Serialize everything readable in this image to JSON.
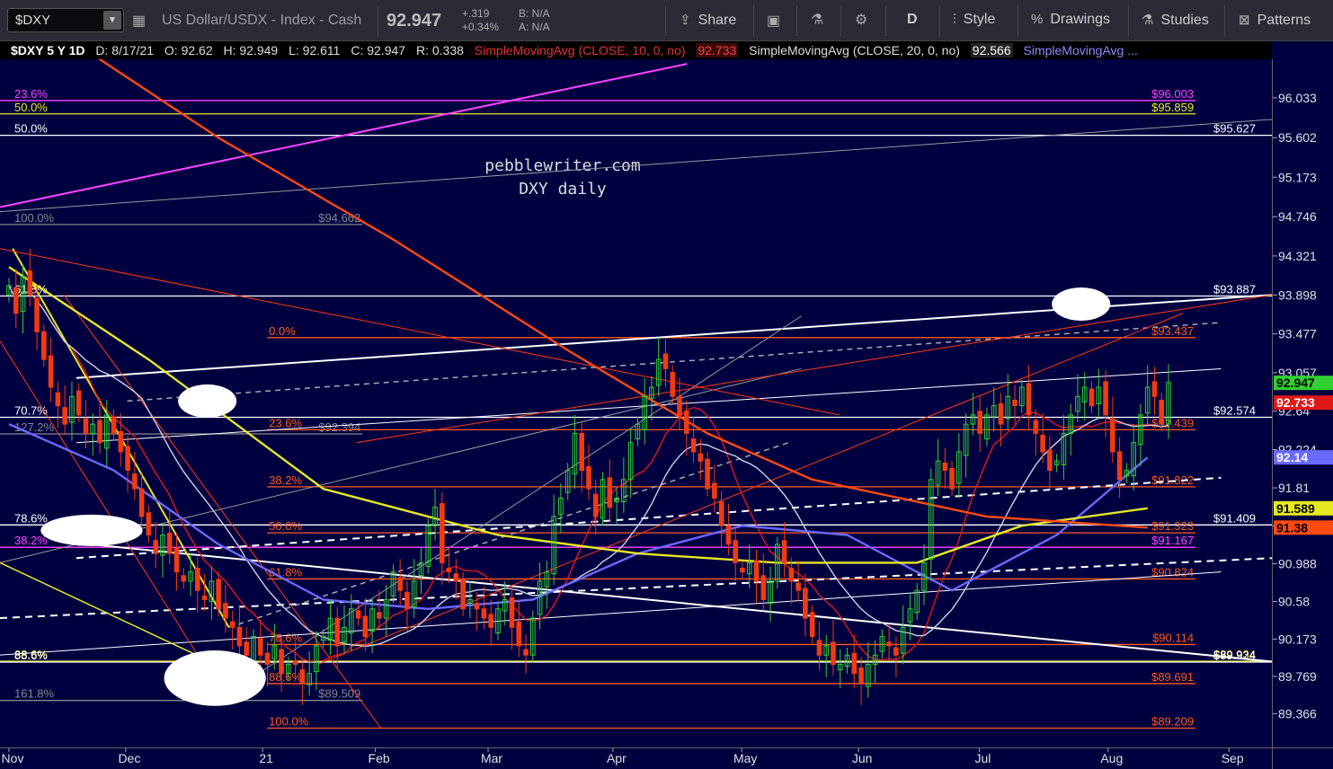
{
  "toolbar": {
    "symbol": "$DXY",
    "description": "US Dollar/USDX - Index - Cash",
    "last": "92.947",
    "change": "+.319",
    "change_pct": "+0.34%",
    "bid": "B: N/A",
    "ask": "A: N/A",
    "period_button": "D",
    "buttons": [
      {
        "label": "Share",
        "icon": "share-icon"
      },
      {
        "label": "Style",
        "icon": "style-icon"
      },
      {
        "label": "Drawings",
        "icon": "drawings-icon"
      },
      {
        "label": "Studies",
        "icon": "studies-icon"
      },
      {
        "label": "Patterns",
        "icon": "patterns-icon"
      }
    ]
  },
  "status": {
    "symbol": "$DXY 5 Y 1D",
    "date": "D: 8/17/21",
    "open": "O: 92.62",
    "high": "H: 92.949",
    "low": "L: 92.611",
    "close": "C: 92.947",
    "range": "R: 0.338",
    "sma10_label": "SimpleMovingAvg (CLOSE, 10, 0, no)",
    "sma10_value": "92.733",
    "sma20_label": "SimpleMovingAvg (CLOSE, 20, 0, no)",
    "sma20_value": "92.566",
    "sma_more_label": "SimpleMovingAvg ..."
  },
  "colors": {
    "background": "#000040",
    "up": "#2fd02f",
    "down": "#f03a10",
    "sma10": "#e01818",
    "sma20": "#d0d0e0",
    "sma50": "#6a6aff",
    "sma100": "#e8e820",
    "sma200": "#ff4a10",
    "fib_orange": "#ff5a1a",
    "fib_magenta": "#ff44ff"
  },
  "chart_data": {
    "type": "candlestick",
    "watermark_lines": [
      "pebblewriter.com",
      "DXY daily"
    ],
    "y_axis": {
      "range": [
        89.0,
        96.45
      ],
      "ticks": [
        96.033,
        95.602,
        95.173,
        94.746,
        94.321,
        93.898,
        93.477,
        93.057,
        92.64,
        92.224,
        91.81,
        91.398,
        90.988,
        90.58,
        90.173,
        89.769,
        89.366
      ],
      "tick_labels": [
        "96.033",
        "95.602",
        "95.173",
        "94.746",
        "94.321",
        "93.898",
        "93.477",
        "93.057",
        "92.64",
        "92.224",
        "91.81",
        "91.398",
        "90.988",
        "90.58",
        "90.173",
        "89.769",
        "89.366"
      ]
    },
    "x_axis": {
      "labels": [
        "Nov",
        "Dec",
        "21",
        "Feb",
        "Mar",
        "Apr",
        "May",
        "Jun",
        "Jul",
        "Aug",
        "Sep"
      ],
      "label_dates": [
        "2020-11-02",
        "2020-12-01",
        "2021-01-04",
        "2021-02-01",
        "2021-03-01",
        "2021-04-01",
        "2021-05-03",
        "2021-06-01",
        "2021-07-01",
        "2021-08-02",
        "2021-09-01"
      ],
      "last_date": "2021-08-17"
    },
    "price_markers": [
      {
        "label": "92.947",
        "value": 92.947,
        "color": "#2fd02f",
        "text": "#000000"
      },
      {
        "label": "92.733",
        "value": 92.733,
        "color": "#e01818",
        "text": "#ffffff"
      },
      {
        "label": "92.14",
        "value": 92.14,
        "color": "#6a6aff",
        "text": "#ffffff"
      },
      {
        "label": "91.589",
        "value": 91.589,
        "color": "#e8e820",
        "text": "#000000"
      },
      {
        "label": "91.38",
        "value": 91.38,
        "color": "#ff4a10",
        "text": "#000000"
      }
    ],
    "horizontal_levels": [
      {
        "value": 96.003,
        "color": "#ff44ff",
        "label_left": "23.6%",
        "label_right": "$96.003",
        "x_from": 0.0,
        "x_to": 0.94
      },
      {
        "value": 95.859,
        "color": "#e8e820",
        "label_left": "50.0%",
        "label_right": "$95.859",
        "x_from": 0.0,
        "x_to": 0.94
      },
      {
        "value": 95.627,
        "color": "#ffffff",
        "label_left": "50.0%",
        "label_right": "$95.627",
        "x_from": 0.0,
        "x_to": 1.0
      },
      {
        "value": 94.662,
        "color": "#888888",
        "label_left": "100.0%",
        "label_right": "$94.662",
        "x_from": 0.0,
        "x_to": 0.285
      },
      {
        "value": 93.887,
        "color": "#ffffff",
        "label_left": "61.8%",
        "label_right": "$93.887",
        "x_from": 0.0,
        "x_to": 1.0
      },
      {
        "value": 93.437,
        "color": "#ff5a1a",
        "label_left": "0.0%",
        "label_right": "$93.437",
        "x_from": 0.21,
        "x_to": 0.94
      },
      {
        "value": 92.574,
        "color": "#ffffff",
        "label_left": "70.7%",
        "label_right": "$92.574",
        "x_from": 0.0,
        "x_to": 1.0
      },
      {
        "value": 92.394,
        "color": "#888888",
        "label_left": "127.2%",
        "label_right": "$92.394",
        "x_from": 0.0,
        "x_to": 0.285
      },
      {
        "value": 92.439,
        "color": "#ff5a1a",
        "label_left": "23.6%",
        "label_right": "$92.439",
        "x_from": 0.21,
        "x_to": 0.94
      },
      {
        "value": 91.822,
        "color": "#ff5a1a",
        "label_left": "38.2%",
        "label_right": "$91.822",
        "x_from": 0.21,
        "x_to": 0.94
      },
      {
        "value": 91.409,
        "color": "#ffffff",
        "label_left": "78.6%",
        "label_right": "$91.409",
        "x_from": 0.0,
        "x_to": 1.0
      },
      {
        "value": 91.323,
        "color": "#ff5a1a",
        "label_left": "50.0%",
        "label_right": "$91.323",
        "x_from": 0.21,
        "x_to": 0.94
      },
      {
        "value": 91.167,
        "color": "#ff44ff",
        "label_left": "38.2%",
        "label_right": "$91.167",
        "x_from": 0.0,
        "x_to": 0.94
      },
      {
        "value": 90.824,
        "color": "#ff5a1a",
        "label_left": "61.8%",
        "label_right": "$90.824",
        "x_from": 0.21,
        "x_to": 0.94
      },
      {
        "value": 90.114,
        "color": "#ff5a1a",
        "label_left": "78.6%",
        "label_right": "$90.114",
        "x_from": 0.21,
        "x_to": 0.94
      },
      {
        "value": 89.934,
        "color": "#e8e820",
        "label_left": "88.6%",
        "label_right": "$89.934",
        "x_from": 0.0,
        "x_to": 1.0
      },
      {
        "value": 89.924,
        "color": "#ffffff",
        "label_left": "88.6%",
        "label_right": "$89.924",
        "x_from": 0.0,
        "x_to": 1.0
      },
      {
        "value": 89.691,
        "color": "#ff5a1a",
        "label_left": "88.6%",
        "label_right": "$89.691",
        "x_from": 0.21,
        "x_to": 0.94
      },
      {
        "value": 89.509,
        "color": "#888888",
        "label_left": "161.8%",
        "label_right": "$89.509",
        "x_from": 0.0,
        "x_to": 0.285
      },
      {
        "value": 89.209,
        "color": "#ff5a1a",
        "label_left": "100.0%",
        "label_right": "$89.209",
        "x_from": 0.21,
        "x_to": 0.94
      }
    ],
    "closes": [
      94.0,
      93.7,
      94.1,
      93.9,
      93.5,
      93.2,
      92.9,
      92.7,
      92.5,
      92.8,
      92.6,
      92.4,
      92.5,
      92.3,
      92.6,
      92.4,
      92.2,
      92.0,
      91.8,
      91.5,
      91.3,
      91.1,
      91.3,
      91.1,
      90.9,
      90.8,
      90.9,
      90.7,
      90.6,
      90.8,
      90.5,
      90.4,
      90.3,
      90.1,
      90.0,
      90.2,
      90.0,
      89.9,
      90.1,
      89.8,
      89.9,
      89.9,
      89.7,
      89.8,
      90.1,
      90.2,
      90.4,
      90.1,
      90.3,
      90.5,
      90.4,
      90.2,
      90.5,
      90.4,
      90.6,
      90.9,
      90.7,
      90.5,
      90.8,
      91.0,
      91.4,
      91.6,
      91.0,
      90.9,
      90.8,
      90.5,
      90.6,
      90.5,
      90.4,
      90.3,
      90.5,
      90.6,
      90.3,
      90.1,
      90.0,
      90.4,
      90.8,
      90.9,
      91.5,
      91.7,
      92.0,
      92.4,
      92.0,
      91.8,
      91.5,
      91.9,
      91.6,
      91.7,
      91.9,
      92.3,
      92.5,
      92.8,
      92.9,
      93.2,
      93.1,
      92.8,
      92.6,
      92.4,
      92.2,
      92.1,
      91.8,
      91.7,
      91.4,
      91.2,
      91.0,
      90.9,
      91.0,
      90.8,
      90.6,
      90.8,
      91.2,
      91.0,
      90.8,
      90.7,
      90.4,
      90.2,
      90.0,
      90.1,
      89.9,
      89.9,
      90.0,
      89.8,
      89.7,
      89.9,
      90.0,
      90.2,
      90.1,
      90.0,
      90.3,
      90.5,
      90.7,
      91.0,
      91.9,
      92.1,
      92.0,
      91.8,
      92.2,
      92.5,
      92.6,
      92.4,
      92.6,
      92.7,
      92.5,
      92.8,
      92.7,
      92.9,
      92.6,
      92.4,
      92.2,
      92.0,
      92.1,
      92.4,
      92.6,
      92.8,
      92.9,
      92.7,
      92.9,
      92.6,
      92.2,
      91.9,
      92.0,
      92.3,
      92.6,
      92.9,
      92.8,
      92.5,
      92.95
    ],
    "moving_averages": [
      {
        "name": "SMA 10",
        "color": "#e01818",
        "period": 10
      },
      {
        "name": "SMA 20",
        "color": "#d0d0e0",
        "period": 20
      },
      {
        "name": "SMA 50",
        "color": "#6a6aff",
        "points": [
          [
            0,
            92.5
          ],
          [
            15,
            92.0
          ],
          [
            30,
            91.2
          ],
          [
            45,
            90.6
          ],
          [
            60,
            90.5
          ],
          [
            75,
            90.6
          ],
          [
            90,
            91.1
          ],
          [
            105,
            91.4
          ],
          [
            120,
            91.3
          ],
          [
            135,
            90.7
          ],
          [
            150,
            91.3
          ],
          [
            163,
            92.14
          ]
        ]
      },
      {
        "name": "SMA 100",
        "color": "#e8e820",
        "points": [
          [
            0,
            94.2
          ],
          [
            20,
            93.2
          ],
          [
            45,
            91.8
          ],
          [
            70,
            91.3
          ],
          [
            90,
            91.1
          ],
          [
            110,
            91.0
          ],
          [
            130,
            91.0
          ],
          [
            145,
            91.4
          ],
          [
            163,
            91.589
          ]
        ]
      },
      {
        "name": "SMA 200",
        "color": "#ff4a10",
        "points": [
          [
            8,
            96.7
          ],
          [
            30,
            95.6
          ],
          [
            55,
            94.5
          ],
          [
            80,
            93.3
          ],
          [
            100,
            92.4
          ],
          [
            115,
            91.9
          ],
          [
            140,
            91.5
          ],
          [
            163,
            91.38
          ]
        ]
      }
    ],
    "trendlines": [
      {
        "color": "#ffffff",
        "width": 2,
        "dash": "",
        "from": [
          0.07,
          91.2
        ],
        "to": [
          1.0,
          89.93
        ]
      },
      {
        "color": "#ffffff",
        "width": 2,
        "dash": "",
        "from": [
          0.06,
          93.0
        ],
        "to": [
          1.0,
          93.9
        ]
      },
      {
        "color": "#ffffff",
        "width": 1,
        "dash": "",
        "from": [
          0.06,
          92.3
        ],
        "to": [
          0.96,
          93.1
        ]
      },
      {
        "color": "#ffffff",
        "width": 2,
        "dash": "8,6",
        "from": [
          0.0,
          90.4
        ],
        "to": [
          1.0,
          91.05
        ]
      },
      {
        "color": "#ffffff",
        "width": 2,
        "dash": "8,6",
        "from": [
          0.06,
          91.05
        ],
        "to": [
          0.96,
          91.92
        ]
      },
      {
        "color": "#ffffff",
        "width": 1,
        "dash": "",
        "from": [
          0.0,
          90.0
        ],
        "to": [
          0.96,
          90.9
        ]
      },
      {
        "color": "#aaaaaa",
        "width": 1.5,
        "dash": "6,5",
        "from": [
          0.1,
          92.75
        ],
        "to": [
          0.96,
          93.6
        ]
      },
      {
        "color": "#aaaaaa",
        "width": 1.5,
        "dash": "6,5",
        "from": [
          0.18,
          90.3
        ],
        "to": [
          0.62,
          92.3
        ]
      },
      {
        "color": "#999999",
        "width": 1,
        "dash": "",
        "from": [
          0.17,
          89.5
        ],
        "to": [
          0.63,
          93.67
        ]
      },
      {
        "color": "#999999",
        "width": 1,
        "dash": "",
        "from": [
          0.0,
          94.8
        ],
        "to": [
          1.0,
          95.8
        ]
      },
      {
        "color": "#999999",
        "width": 1,
        "dash": "",
        "from": [
          0.0,
          91.0
        ],
        "to": [
          0.63,
          93.1
        ]
      },
      {
        "color": "#ff44ff",
        "width": 2,
        "dash": "",
        "from": [
          0.0,
          94.85
        ],
        "to": [
          0.54,
          96.4
        ]
      },
      {
        "color": "#e8e820",
        "width": 1.5,
        "dash": "",
        "from": [
          0.0,
          91.0
        ],
        "to": [
          0.17,
          89.9
        ]
      },
      {
        "color": "#e8e820",
        "width": 2,
        "dash": "",
        "from": [
          0.01,
          94.4
        ],
        "to": [
          0.18,
          90.3
        ]
      },
      {
        "color": "#ff3a10",
        "width": 1,
        "dash": "",
        "from": [
          0.0,
          94.4
        ],
        "to": [
          0.66,
          92.6
        ]
      },
      {
        "color": "#ff3a10",
        "width": 1,
        "dash": "",
        "from": [
          0.0,
          93.4
        ],
        "to": [
          0.16,
          89.9
        ]
      },
      {
        "color": "#ff3a10",
        "width": 1,
        "dash": "",
        "from": [
          0.05,
          93.9
        ],
        "to": [
          0.3,
          89.2
        ]
      },
      {
        "color": "#ff3a10",
        "width": 1,
        "dash": "",
        "from": [
          0.25,
          89.9
        ],
        "to": [
          0.93,
          93.7
        ]
      },
      {
        "color": "#ff3a10",
        "width": 1,
        "dash": "",
        "from": [
          0.28,
          92.3
        ],
        "to": [
          1.0,
          93.9
        ]
      }
    ],
    "annotations": [
      {
        "type": "ellipse",
        "cx": 0.163,
        "cy": 92.75,
        "rx": 0.023,
        "ry": 0.18
      },
      {
        "type": "ellipse",
        "cx": 0.072,
        "cy": 91.35,
        "rx": 0.04,
        "ry": 0.17
      },
      {
        "type": "ellipse",
        "cx": 0.169,
        "cy": 89.75,
        "rx": 0.04,
        "ry": 0.3
      },
      {
        "type": "ellipse",
        "cx": 0.85,
        "cy": 93.8,
        "rx": 0.023,
        "ry": 0.18
      }
    ]
  }
}
